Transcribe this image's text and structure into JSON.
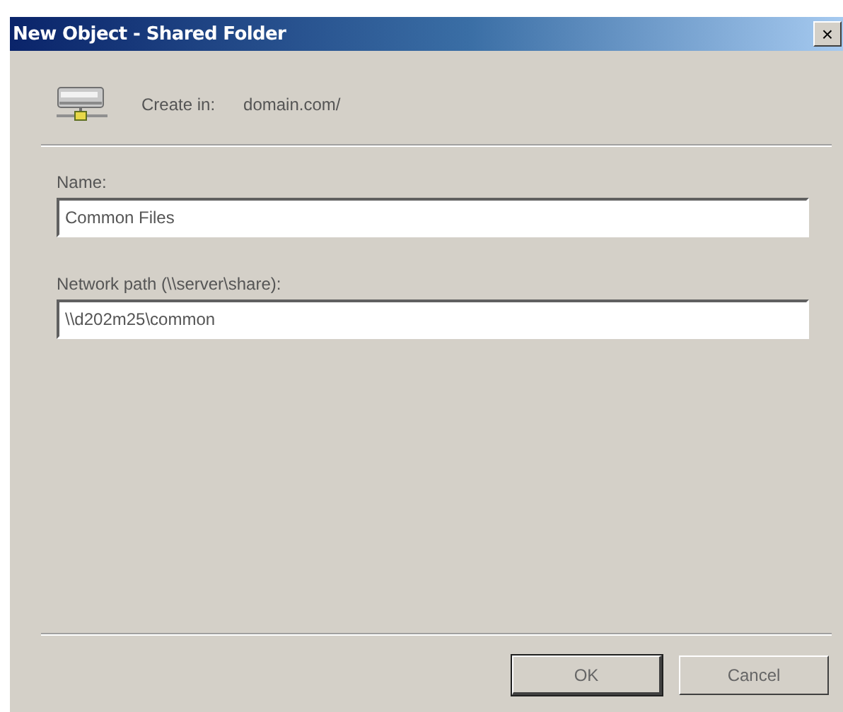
{
  "window": {
    "title": "New Object - Shared Folder",
    "close": "×"
  },
  "header": {
    "label": "Create in:",
    "value": "domain.com/"
  },
  "fields": [
    {
      "label": "Name:",
      "value": "Common Files"
    },
    {
      "label": "Network path (\\\\server\\share):",
      "value": "\\\\d202m25\\common"
    }
  ],
  "buttons": [
    {
      "label": "OK",
      "default": true
    },
    {
      "label": "Cancel",
      "default": false
    }
  ]
}
